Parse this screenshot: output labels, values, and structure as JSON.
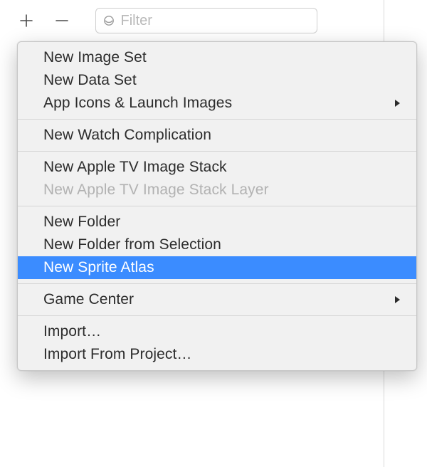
{
  "toolbar": {
    "add_icon": "plus",
    "remove_icon": "minus",
    "filter_placeholder": "Filter",
    "filter_value": ""
  },
  "menu": {
    "groups": [
      {
        "items": [
          {
            "label": "New Image Set",
            "submenu": false,
            "disabled": false,
            "selected": false
          },
          {
            "label": "New Data Set",
            "submenu": false,
            "disabled": false,
            "selected": false
          },
          {
            "label": "App Icons & Launch Images",
            "submenu": true,
            "disabled": false,
            "selected": false
          }
        ]
      },
      {
        "items": [
          {
            "label": "New Watch Complication",
            "submenu": false,
            "disabled": false,
            "selected": false
          }
        ]
      },
      {
        "items": [
          {
            "label": "New Apple TV Image Stack",
            "submenu": false,
            "disabled": false,
            "selected": false
          },
          {
            "label": "New Apple TV Image Stack Layer",
            "submenu": false,
            "disabled": true,
            "selected": false
          }
        ]
      },
      {
        "items": [
          {
            "label": "New Folder",
            "submenu": false,
            "disabled": false,
            "selected": false
          },
          {
            "label": "New Folder from Selection",
            "submenu": false,
            "disabled": false,
            "selected": false
          },
          {
            "label": "New Sprite Atlas",
            "submenu": false,
            "disabled": false,
            "selected": true
          }
        ]
      },
      {
        "items": [
          {
            "label": "Game Center",
            "submenu": true,
            "disabled": false,
            "selected": false
          }
        ]
      },
      {
        "items": [
          {
            "label": "Import…",
            "submenu": false,
            "disabled": false,
            "selected": false
          },
          {
            "label": "Import From Project…",
            "submenu": false,
            "disabled": false,
            "selected": false
          }
        ]
      }
    ]
  }
}
